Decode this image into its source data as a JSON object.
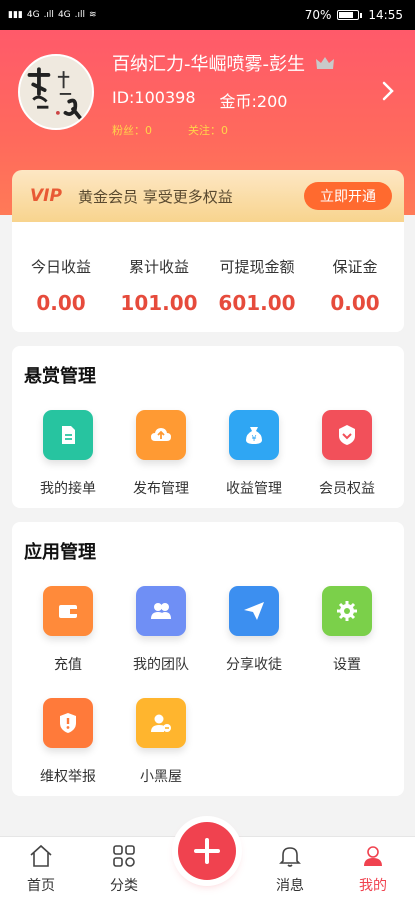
{
  "status_bar": {
    "battery": "70%",
    "time": "14:55",
    "signal_left": "4G",
    "signal_right": "4G"
  },
  "profile": {
    "name": "百纳汇力-华崛喷雾-彭生",
    "id_text": "ID:100398",
    "coins_text": "金币:200",
    "fans_text": "粉丝：0",
    "follow_text": "关注：0"
  },
  "vip": {
    "tag": "VIP",
    "text": "黄金会员 享受更多权益",
    "button": "立即开通"
  },
  "earnings": [
    {
      "label": "今日收益",
      "value": "0.00"
    },
    {
      "label": "累计收益",
      "value": "101.00"
    },
    {
      "label": "可提现金额",
      "value": "601.00"
    },
    {
      "label": "保证金",
      "value": "0.00"
    }
  ],
  "reward_section": {
    "title": "悬赏管理",
    "items": [
      {
        "label": "我的接单",
        "icon": "document-icon",
        "color": "#27c4a0"
      },
      {
        "label": "发布管理",
        "icon": "cloud-upload-icon",
        "color": "#ff9a33"
      },
      {
        "label": "收益管理",
        "icon": "money-bag-icon",
        "color": "#2fa6f3"
      },
      {
        "label": "会员权益",
        "icon": "badge-icon",
        "color": "#f2505a"
      }
    ]
  },
  "app_section": {
    "title": "应用管理",
    "items": [
      {
        "label": "充值",
        "icon": "wallet-icon",
        "color": "#ff8a3a"
      },
      {
        "label": "我的团队",
        "icon": "team-icon",
        "color": "#6f8ff5"
      },
      {
        "label": "分享收徒",
        "icon": "paper-plane-icon",
        "color": "#3c8ff0"
      },
      {
        "label": "设置",
        "icon": "gear-icon",
        "color": "#7bd04a"
      },
      {
        "label": "维权举报",
        "icon": "shield-alert-icon",
        "color": "#ff7a3a"
      },
      {
        "label": "小黑屋",
        "icon": "user-block-icon",
        "color": "#ffb52e"
      }
    ]
  },
  "bottom_nav": [
    {
      "label": "首页",
      "icon": "home-icon"
    },
    {
      "label": "分类",
      "icon": "grid-icon"
    },
    {
      "label": "消息",
      "icon": "bell-icon"
    },
    {
      "label": "我的",
      "icon": "profile-icon",
      "active": true
    }
  ],
  "colors": {
    "accent": "#f0424f",
    "value_red": "#e64b3c",
    "active_nav": "#f0424f"
  }
}
